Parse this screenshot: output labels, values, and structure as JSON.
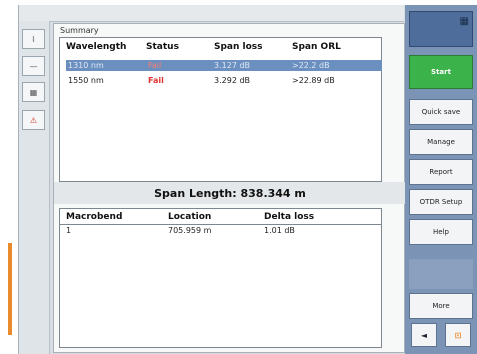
{
  "summary": {
    "label": "Summary"
  },
  "results": {
    "headers": [
      "Wavelength",
      "Status",
      "Span loss",
      "Span ORL"
    ],
    "rows": [
      {
        "wavelength": "1310 nm",
        "status": "Fail",
        "span_loss": "3.127 dB",
        "span_orl": ">22.2 dB",
        "selected": true
      },
      {
        "wavelength": "1550 nm",
        "status": "Fail",
        "span_loss": "3.292 dB",
        "span_orl": ">22.89 dB",
        "selected": false
      }
    ]
  },
  "span": {
    "text": "Span Length: 838.344 m"
  },
  "events": {
    "headers": [
      "Macrobend",
      "Location",
      "Delta loss"
    ],
    "rows": [
      {
        "macrobend": "1",
        "location": "705.959 m",
        "delta_loss": "1.01 dB"
      }
    ]
  },
  "sidebar_right": {
    "top_label": "",
    "start_label": "Start",
    "buttons": [
      "Quick save",
      "Manage",
      "Report",
      "OTDR Setup",
      "Help",
      "More"
    ],
    "bottom_left": "◄",
    "bottom_right": "⊡"
  },
  "left_tools": [
    {
      "name": "trace",
      "glyph": "⌇"
    },
    {
      "name": "fiber",
      "glyph": "—"
    },
    {
      "name": "table",
      "glyph": "▦"
    },
    {
      "name": "alert",
      "glyph": "⚠"
    }
  ],
  "colors": {
    "accent": "#3bb24a",
    "selection": "#6b8fbf",
    "fail": "#e03030",
    "sidebar": "#7b93b4",
    "left_edge": "#e98a2c"
  }
}
